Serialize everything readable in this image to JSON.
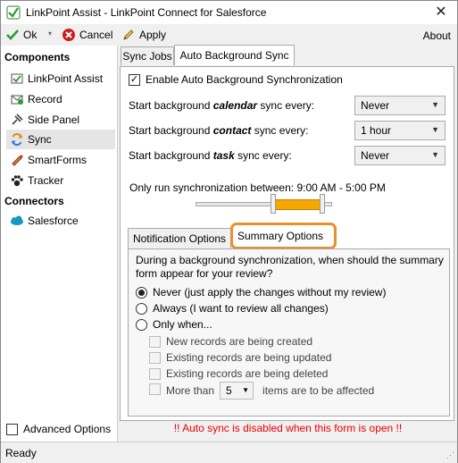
{
  "window": {
    "title": "LinkPoint Assist - LinkPoint Connect for Salesforce",
    "close_glyph": "✕"
  },
  "toolbar": {
    "ok_label": "Ok",
    "cancel_label": "Cancel",
    "apply_label": "Apply",
    "about_label": "About",
    "separator_glyph": "▾"
  },
  "sidebar": {
    "components_header": "Components",
    "items": [
      {
        "label": "LinkPoint Assist",
        "icon": "linkpoint-icon"
      },
      {
        "label": "Record",
        "icon": "record-icon"
      },
      {
        "label": "Side Panel",
        "icon": "side-panel-icon"
      },
      {
        "label": "Sync",
        "icon": "sync-icon",
        "selected": true
      },
      {
        "label": "SmartForms",
        "icon": "smartforms-icon"
      },
      {
        "label": "Tracker",
        "icon": "tracker-icon"
      }
    ],
    "connectors_header": "Connectors",
    "connectors": [
      {
        "label": "Salesforce",
        "icon": "salesforce-cloud-icon"
      }
    ],
    "advanced_options_label": "Advanced Options",
    "advanced_options_checked": false
  },
  "tabs": {
    "sync_jobs": "Sync Jobs",
    "auto_bg_sync": "Auto Background Sync",
    "active": "Auto Background Sync"
  },
  "auto_sync": {
    "enable_label": "Enable Auto Background Synchronization",
    "enable_checked": true,
    "calendar": {
      "prefix": "Start background ",
      "emph": "calendar",
      "suffix": " sync every:",
      "value": "Never"
    },
    "contact": {
      "prefix": "Start background ",
      "emph": "contact",
      "suffix": " sync every:",
      "value": "1 hour"
    },
    "task": {
      "prefix": "Start background ",
      "emph": "task",
      "suffix": " sync every:",
      "value": "Never"
    },
    "window_label": "Only run synchronization between:",
    "window_value": "9:00 AM - 5:00 PM",
    "range_start_fraction": 0.375,
    "range_end_fraction": 0.708
  },
  "inner_tabs": {
    "notification": "Notification Options",
    "summary": "Summary Options",
    "active": "Summary Options"
  },
  "summary": {
    "question": "During a background synchronization, when should the summary form appear for your review?",
    "options": [
      {
        "label": "Never (just apply the changes without my review)",
        "selected": true
      },
      {
        "label": "Always (I want to review all changes)",
        "selected": false
      },
      {
        "label": "Only when...",
        "selected": false
      }
    ],
    "conditions": [
      {
        "label": "New records are being created",
        "checked": false
      },
      {
        "label": "Existing records are being updated",
        "checked": false
      },
      {
        "label": "Existing records are being deleted",
        "checked": false
      }
    ],
    "more_than_prefix": "More than",
    "more_than_value": "5",
    "more_than_suffix": "items are to be affected"
  },
  "warning": "!! Auto sync is disabled when this form is open !!",
  "status": "Ready",
  "colors": {
    "accent_orange": "#e8902c",
    "range_fill": "#f7a800",
    "warning_red": "#ee0000"
  }
}
